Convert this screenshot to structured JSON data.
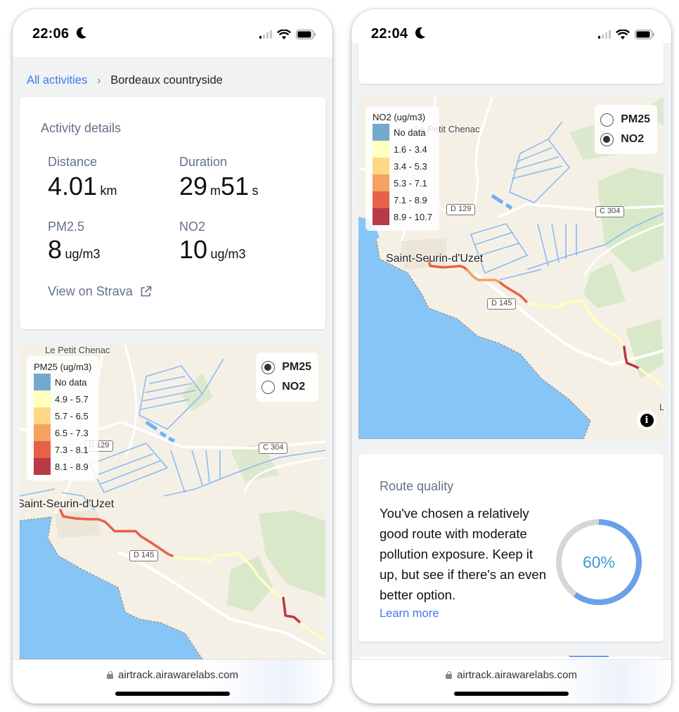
{
  "left_screen": {
    "status_bar": {
      "time": "22:06",
      "focus_icon": "moon-icon",
      "signal_bars_on": 1,
      "signal_bars_total": 4
    },
    "breadcrumb": {
      "parent": "All activities",
      "separator": "›",
      "current": "Bordeaux countryside"
    },
    "activity_details": {
      "title": "Activity details",
      "distance": {
        "label": "Distance",
        "value": "4.01",
        "unit": "km"
      },
      "duration": {
        "label": "Duration",
        "minutes": "29",
        "minutes_unit": "m",
        "seconds": "51",
        "seconds_unit": "s"
      },
      "pm25": {
        "label": "PM2.5",
        "value": "8",
        "unit": "ug/m3"
      },
      "no2": {
        "label": "NO2",
        "value": "10",
        "unit": "ug/m3"
      },
      "strava_link": "View on Strava",
      "strava_icon": "external-link-icon"
    },
    "map": {
      "legend": {
        "title": "PM25 (ug/m3)",
        "items": [
          {
            "label": "No data",
            "color": "#74a9cf"
          },
          {
            "label": "4.9 - 5.7",
            "color": "#ffffbf"
          },
          {
            "label": "5.7 - 6.5",
            "color": "#fdd885"
          },
          {
            "label": "6.5 - 7.3",
            "color": "#f4a261"
          },
          {
            "label": "7.3 - 8.1",
            "color": "#e6614a"
          },
          {
            "label": "8.1 - 8.9",
            "color": "#b83a47"
          }
        ]
      },
      "layer_options": [
        {
          "label": "PM25",
          "selected": true
        },
        {
          "label": "NO2",
          "selected": false
        }
      ],
      "places": {
        "village": "Saint-Seurin-d'Uzet",
        "hamlet": "Le Petit Chenac"
      },
      "roads": [
        "D 129",
        "C 304",
        "D 145"
      ]
    },
    "url_bar": {
      "url": "airtrack.airawarelabs.com"
    }
  },
  "right_screen": {
    "status_bar": {
      "time": "22:04",
      "focus_icon": "moon-icon",
      "signal_bars_on": 1,
      "signal_bars_total": 4
    },
    "map": {
      "legend": {
        "title": "NO2 (ug/m3)",
        "items": [
          {
            "label": "No data",
            "color": "#74a9cf"
          },
          {
            "label": "1.6 - 3.4",
            "color": "#ffffbf"
          },
          {
            "label": "3.4 - 5.3",
            "color": "#fdd885"
          },
          {
            "label": "5.3 - 7.1",
            "color": "#f4a261"
          },
          {
            "label": "7.1 - 8.9",
            "color": "#e6614a"
          },
          {
            "label": "8.9 - 10.7",
            "color": "#b83a47"
          }
        ]
      },
      "layer_options": [
        {
          "label": "PM25",
          "selected": false
        },
        {
          "label": "NO2",
          "selected": true
        }
      ],
      "places": {
        "village": "Saint-Seurin-d'Uzet",
        "hamlet": "Le Petit Chenac",
        "edge_label": "L"
      },
      "roads": [
        "D 129",
        "C 304",
        "D 145"
      ],
      "info_icon": "info-icon"
    },
    "route_quality": {
      "title": "Route quality",
      "description": "You've chosen a relatively good route with moderate pollution exposure. Keep it up, but see if there's an even better option.",
      "learn_more": "Learn more",
      "score_percent": 60,
      "score_label": "60%",
      "progress_color": "#6b9fe8",
      "track_color": "#d6d6d6"
    },
    "url_bar": {
      "url": "airtrack.airawarelabs.com"
    }
  }
}
